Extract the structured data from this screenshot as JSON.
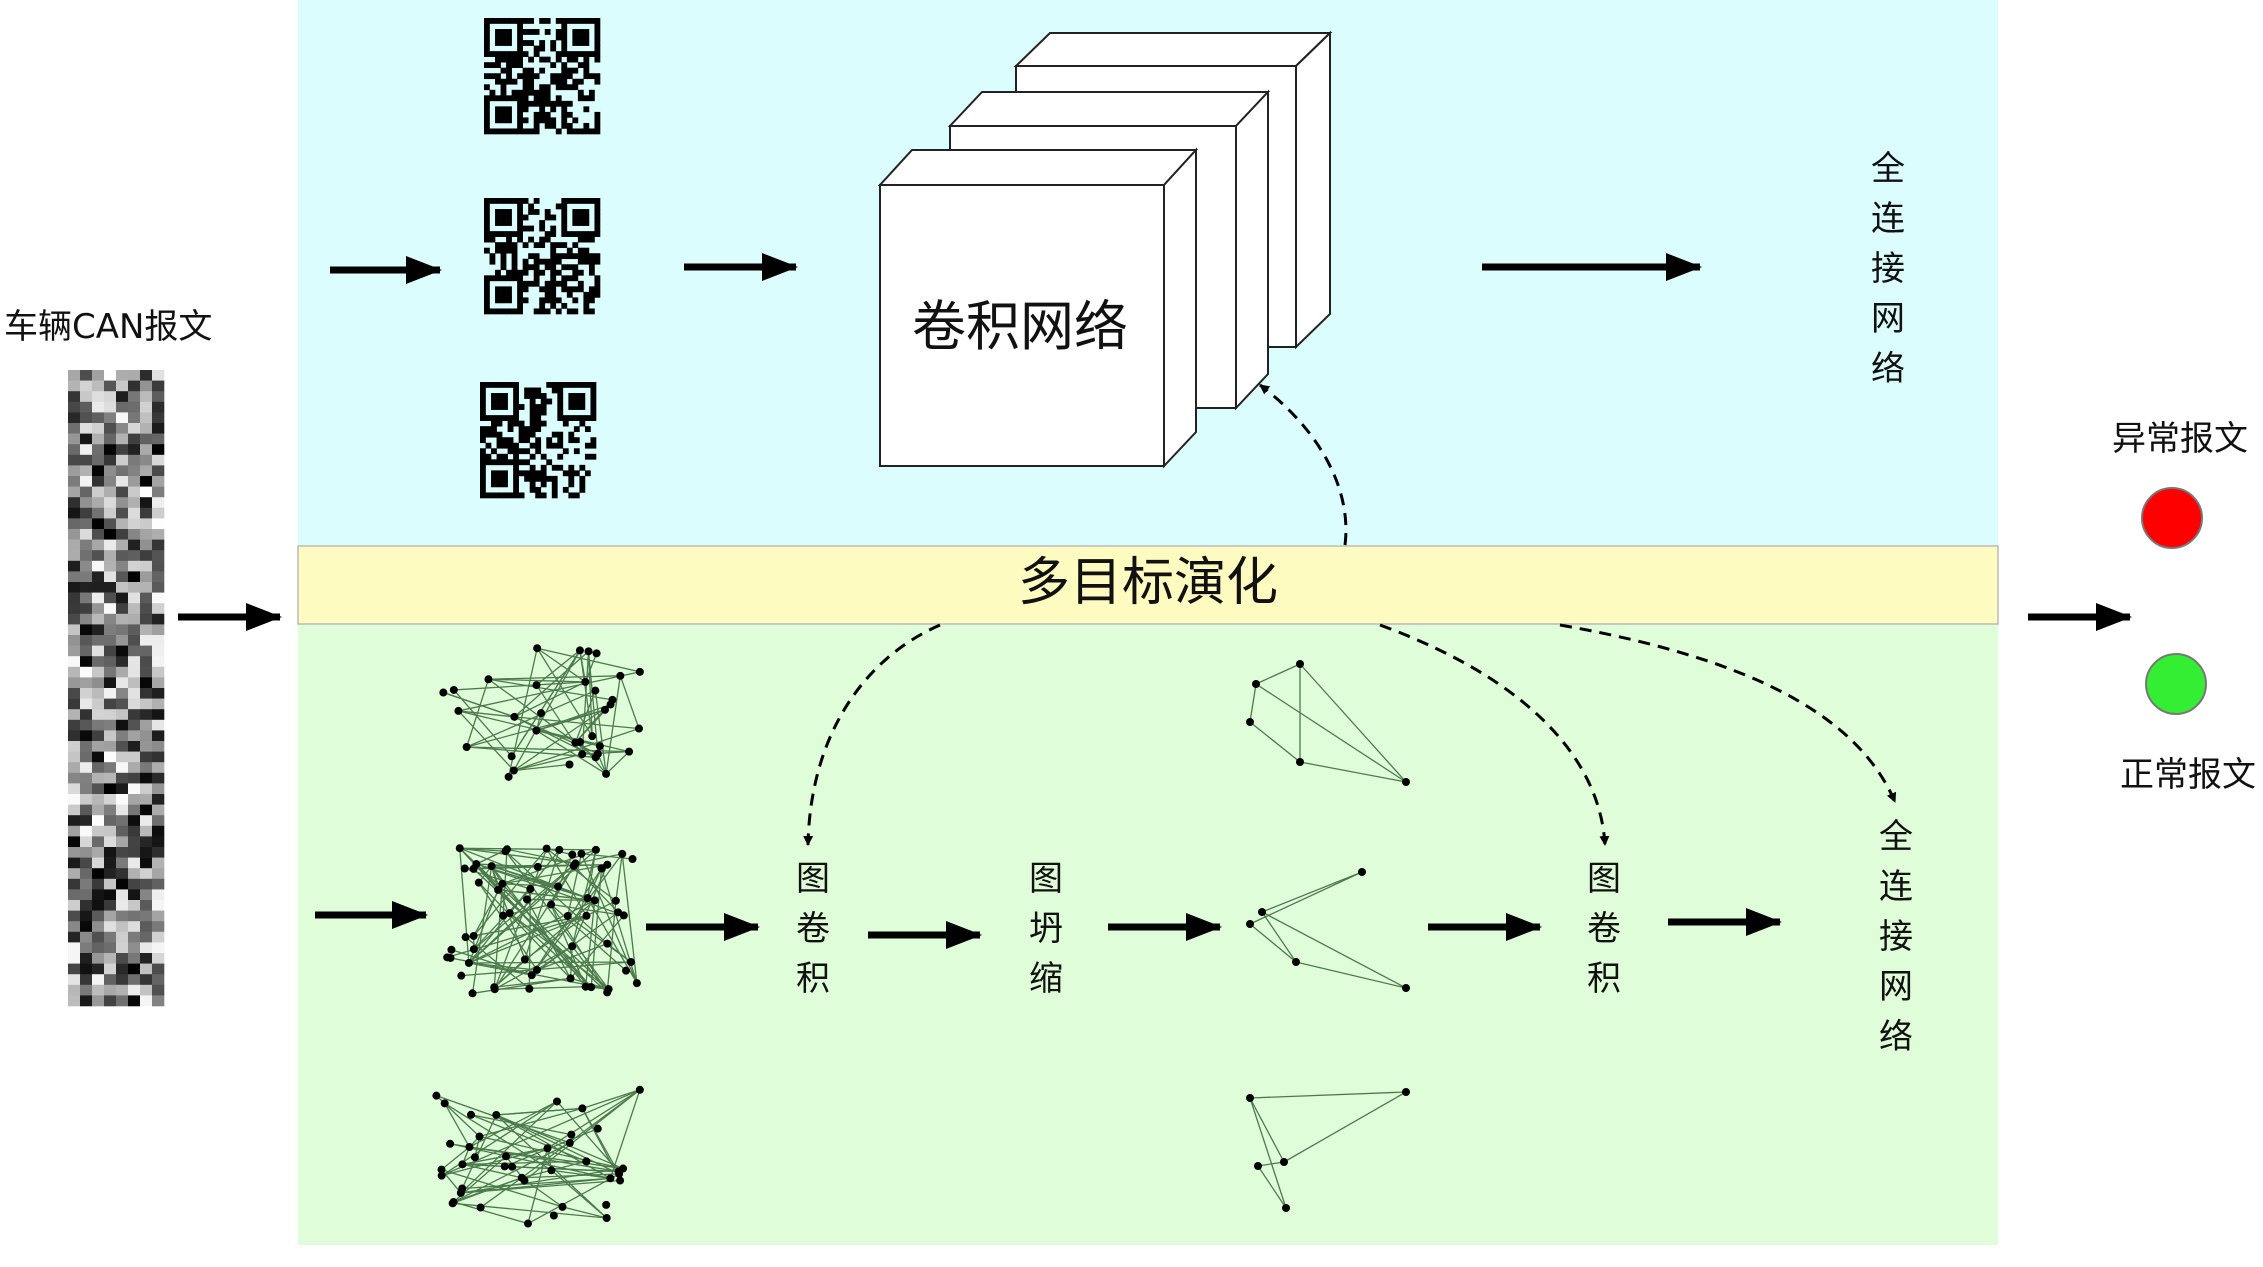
{
  "input": {
    "label": "车辆CAN报文"
  },
  "top_branch": {
    "cnn_label": "卷积网络",
    "fc_label": "全连接网络"
  },
  "evolution": {
    "label": "多目标演化"
  },
  "bottom_branch": {
    "gcn_label_1": "图卷积",
    "pooling_label": "图坍缩",
    "gcn_label_2": "图卷积",
    "fc_label": "全连接网络"
  },
  "output": {
    "abnormal_label": "异常报文",
    "normal_label": "正常报文"
  },
  "colors": {
    "top_bg": "#dcfdfd",
    "middle_bar": "#fdfbc0",
    "bottom_bg": "#dffdd9",
    "abnormal": "#ff0000",
    "normal": "#33ee33",
    "arrow": "#000000",
    "edge": "#4d7a4d"
  },
  "icons": [
    "qr-code-icon",
    "message-grid-icon",
    "graph-icon"
  ]
}
